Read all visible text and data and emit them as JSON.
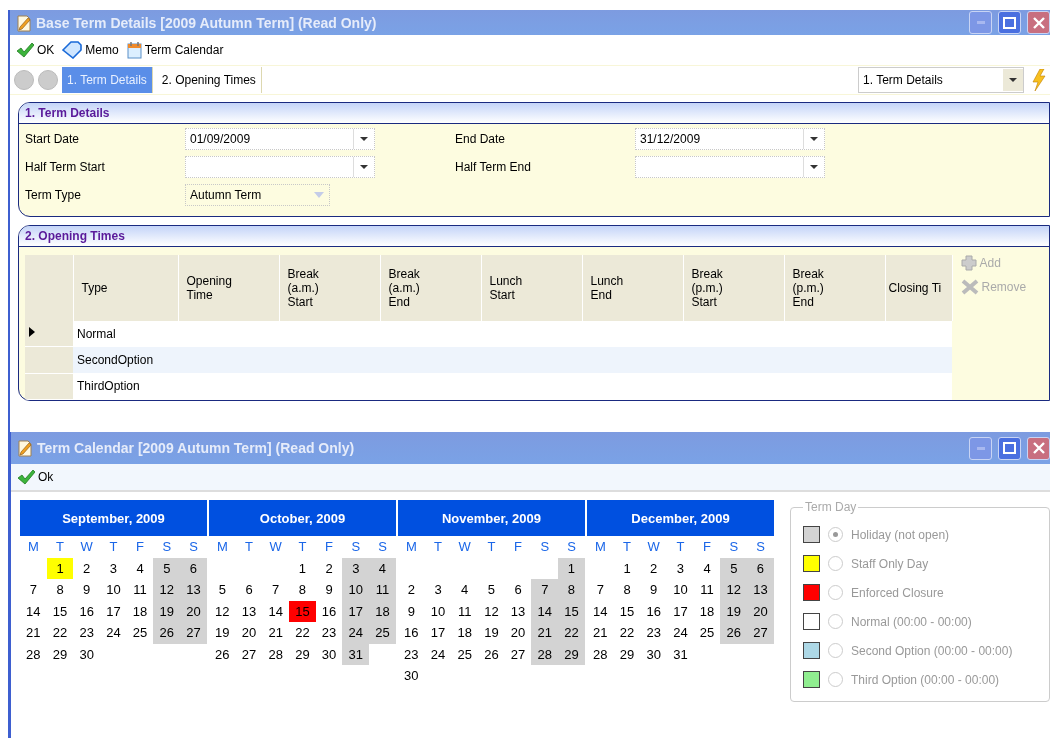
{
  "window": {
    "title": "Base Term Details [2009 Autumn Term] (Read Only)"
  },
  "toolbar": [
    {
      "label": "OK",
      "kind": "ok"
    },
    {
      "label": "Memo",
      "kind": "memo"
    },
    {
      "label": "Term Calendar",
      "kind": "calendar"
    }
  ],
  "tabs": [
    {
      "label": "1. Term Details",
      "selected": true
    },
    {
      "label": "2. Opening Times",
      "selected": false
    }
  ],
  "page_select": {
    "value": "1. Term Details"
  },
  "term_details": {
    "title": "1. Term Details",
    "fields": [
      {
        "label": "Start Date",
        "value": "01/09/2009",
        "kind": "date"
      },
      {
        "label": "End Date",
        "value": "31/12/2009",
        "kind": "date"
      },
      {
        "label": "Half Term Start",
        "kind": "date"
      },
      {
        "label": "Half Term End",
        "kind": "date"
      },
      {
        "label": "Term Type",
        "value": "Autumn Term",
        "kind": "combo"
      }
    ]
  },
  "opening_times": {
    "title": "2. Opening Times",
    "columns": [
      "Type",
      "Opening\nTime",
      "Break\n(a.m.)\nStart",
      "Break\n(a.m.)\nEnd",
      "Lunch\nStart",
      "Lunch\nEnd",
      "Break\n(p.m.)\nStart",
      "Break\n(p.m.)\nEnd",
      "Closing Ti"
    ],
    "rows": [
      {
        "type": "Normal",
        "current": true
      },
      {
        "type": "SecondOption",
        "current": false
      },
      {
        "type": "ThirdOption",
        "current": false
      }
    ],
    "actions": [
      {
        "label": "Add",
        "kind": "add"
      },
      {
        "label": "Remove",
        "kind": "remove"
      }
    ]
  },
  "calendar_window": {
    "title": "Term Calendar [2009 Autumn Term] (Read Only)",
    "ok": "Ok",
    "months": [
      {
        "title": "September, 2009",
        "weekdays": [
          "M",
          "T",
          "W",
          "T",
          "F",
          "S",
          "S"
        ],
        "weeks": [
          [
            {
              "kind": "blank"
            },
            {
              "d": "1",
              "kind": "staff"
            },
            {
              "d": "2",
              "kind": "normal"
            },
            {
              "d": "3",
              "kind": "normal"
            },
            {
              "d": "4",
              "kind": "normal"
            },
            {
              "d": "5",
              "kind": "holiday"
            },
            {
              "d": "6",
              "kind": "holiday"
            }
          ],
          [
            {
              "d": "7",
              "kind": "normal"
            },
            {
              "d": "8",
              "kind": "normal"
            },
            {
              "d": "9",
              "kind": "normal"
            },
            {
              "d": "10",
              "kind": "normal"
            },
            {
              "d": "11",
              "kind": "normal"
            },
            {
              "d": "12",
              "kind": "holiday"
            },
            {
              "d": "13",
              "kind": "holiday"
            }
          ],
          [
            {
              "d": "14",
              "kind": "normal"
            },
            {
              "d": "15",
              "kind": "normal"
            },
            {
              "d": "16",
              "kind": "normal"
            },
            {
              "d": "17",
              "kind": "normal"
            },
            {
              "d": "18",
              "kind": "normal"
            },
            {
              "d": "19",
              "kind": "holiday"
            },
            {
              "d": "20",
              "kind": "holiday"
            }
          ],
          [
            {
              "d": "21",
              "kind": "normal"
            },
            {
              "d": "22",
              "kind": "normal"
            },
            {
              "d": "23",
              "kind": "normal"
            },
            {
              "d": "24",
              "kind": "normal"
            },
            {
              "d": "25",
              "kind": "normal"
            },
            {
              "d": "26",
              "kind": "holiday"
            },
            {
              "d": "27",
              "kind": "holiday"
            }
          ],
          [
            {
              "d": "28",
              "kind": "normal"
            },
            {
              "d": "29",
              "kind": "normal"
            },
            {
              "d": "30",
              "kind": "normal"
            }
          ]
        ]
      },
      {
        "title": "October, 2009",
        "weekdays": [
          "M",
          "T",
          "W",
          "T",
          "F",
          "S",
          "S"
        ],
        "weeks": [
          [
            {
              "kind": "blank"
            },
            {
              "kind": "blank"
            },
            {
              "kind": "blank"
            },
            {
              "d": "1",
              "kind": "normal"
            },
            {
              "d": "2",
              "kind": "normal"
            },
            {
              "d": "3",
              "kind": "holiday"
            },
            {
              "d": "4",
              "kind": "holiday"
            }
          ],
          [
            {
              "d": "5",
              "kind": "normal"
            },
            {
              "d": "6",
              "kind": "normal"
            },
            {
              "d": "7",
              "kind": "normal"
            },
            {
              "d": "8",
              "kind": "normal"
            },
            {
              "d": "9",
              "kind": "normal"
            },
            {
              "d": "10",
              "kind": "holiday"
            },
            {
              "d": "11",
              "kind": "holiday"
            }
          ],
          [
            {
              "d": "12",
              "kind": "normal"
            },
            {
              "d": "13",
              "kind": "normal"
            },
            {
              "d": "14",
              "kind": "normal"
            },
            {
              "d": "15",
              "kind": "closure"
            },
            {
              "d": "16",
              "kind": "normal"
            },
            {
              "d": "17",
              "kind": "holiday"
            },
            {
              "d": "18",
              "kind": "holiday"
            }
          ],
          [
            {
              "d": "19",
              "kind": "normal"
            },
            {
              "d": "20",
              "kind": "normal"
            },
            {
              "d": "21",
              "kind": "normal"
            },
            {
              "d": "22",
              "kind": "normal"
            },
            {
              "d": "23",
              "kind": "normal"
            },
            {
              "d": "24",
              "kind": "holiday"
            },
            {
              "d": "25",
              "kind": "holiday"
            }
          ],
          [
            {
              "d": "26",
              "kind": "normal"
            },
            {
              "d": "27",
              "kind": "normal"
            },
            {
              "d": "28",
              "kind": "normal"
            },
            {
              "d": "29",
              "kind": "normal"
            },
            {
              "d": "30",
              "kind": "normal"
            },
            {
              "d": "31",
              "kind": "holiday"
            }
          ]
        ]
      },
      {
        "title": "November, 2009",
        "weekdays": [
          "M",
          "T",
          "W",
          "T",
          "F",
          "S",
          "S"
        ],
        "weeks": [
          [
            {
              "kind": "blank"
            },
            {
              "kind": "blank"
            },
            {
              "kind": "blank"
            },
            {
              "kind": "blank"
            },
            {
              "kind": "blank"
            },
            {
              "kind": "blank"
            },
            {
              "d": "1",
              "kind": "holiday"
            }
          ],
          [
            {
              "d": "2",
              "kind": "normal"
            },
            {
              "d": "3",
              "kind": "normal"
            },
            {
              "d": "4",
              "kind": "normal"
            },
            {
              "d": "5",
              "kind": "normal"
            },
            {
              "d": "6",
              "kind": "normal"
            },
            {
              "d": "7",
              "kind": "holiday"
            },
            {
              "d": "8",
              "kind": "holiday"
            }
          ],
          [
            {
              "d": "9",
              "kind": "normal"
            },
            {
              "d": "10",
              "kind": "normal"
            },
            {
              "d": "11",
              "kind": "normal"
            },
            {
              "d": "12",
              "kind": "normal"
            },
            {
              "d": "13",
              "kind": "normal"
            },
            {
              "d": "14",
              "kind": "holiday"
            },
            {
              "d": "15",
              "kind": "holiday"
            }
          ],
          [
            {
              "d": "16",
              "kind": "normal"
            },
            {
              "d": "17",
              "kind": "normal"
            },
            {
              "d": "18",
              "kind": "normal"
            },
            {
              "d": "19",
              "kind": "normal"
            },
            {
              "d": "20",
              "kind": "normal"
            },
            {
              "d": "21",
              "kind": "holiday"
            },
            {
              "d": "22",
              "kind": "holiday"
            }
          ],
          [
            {
              "d": "23",
              "kind": "normal"
            },
            {
              "d": "24",
              "kind": "normal"
            },
            {
              "d": "25",
              "kind": "normal"
            },
            {
              "d": "26",
              "kind": "normal"
            },
            {
              "d": "27",
              "kind": "normal"
            },
            {
              "d": "28",
              "kind": "holiday"
            },
            {
              "d": "29",
              "kind": "holiday"
            }
          ],
          [
            {
              "d": "30",
              "kind": "normal"
            }
          ]
        ]
      },
      {
        "title": "December, 2009",
        "weekdays": [
          "M",
          "T",
          "W",
          "T",
          "F",
          "S",
          "S"
        ],
        "weeks": [
          [
            {
              "kind": "blank"
            },
            {
              "d": "1",
              "kind": "normal"
            },
            {
              "d": "2",
              "kind": "normal"
            },
            {
              "d": "3",
              "kind": "normal"
            },
            {
              "d": "4",
              "kind": "normal"
            },
            {
              "d": "5",
              "kind": "holiday"
            },
            {
              "d": "6",
              "kind": "holiday"
            }
          ],
          [
            {
              "d": "7",
              "kind": "normal"
            },
            {
              "d": "8",
              "kind": "normal"
            },
            {
              "d": "9",
              "kind": "normal"
            },
            {
              "d": "10",
              "kind": "normal"
            },
            {
              "d": "11",
              "kind": "normal"
            },
            {
              "d": "12",
              "kind": "holiday"
            },
            {
              "d": "13",
              "kind": "holiday"
            }
          ],
          [
            {
              "d": "14",
              "kind": "normal"
            },
            {
              "d": "15",
              "kind": "normal"
            },
            {
              "d": "16",
              "kind": "normal"
            },
            {
              "d": "17",
              "kind": "normal"
            },
            {
              "d": "18",
              "kind": "normal"
            },
            {
              "d": "19",
              "kind": "holiday"
            },
            {
              "d": "20",
              "kind": "holiday"
            }
          ],
          [
            {
              "d": "21",
              "kind": "normal"
            },
            {
              "d": "22",
              "kind": "normal"
            },
            {
              "d": "23",
              "kind": "normal"
            },
            {
              "d": "24",
              "kind": "normal"
            },
            {
              "d": "25",
              "kind": "normal"
            },
            {
              "d": "26",
              "kind": "holiday"
            },
            {
              "d": "27",
              "kind": "holiday"
            }
          ],
          [
            {
              "d": "28",
              "kind": "normal"
            },
            {
              "d": "29",
              "kind": "normal"
            },
            {
              "d": "30",
              "kind": "normal"
            },
            {
              "d": "31",
              "kind": "normal"
            }
          ]
        ]
      }
    ],
    "legend": {
      "title": "Term Day",
      "items": [
        {
          "label": "Holiday (not open)",
          "kind": "holiday",
          "color": "#d3d3d3",
          "selected": true
        },
        {
          "label": "Staff Only Day",
          "kind": "staff",
          "color": "#ffff00",
          "selected": false
        },
        {
          "label": "Enforced Closure",
          "kind": "closure",
          "color": "#ff0000",
          "selected": false
        },
        {
          "label": "Normal (00:00 - 00:00)",
          "kind": "normal",
          "color": "#ffffff",
          "selected": false
        },
        {
          "label": "Second Option (00:00 - 00:00)",
          "kind": "second",
          "color": "#add8e6",
          "selected": false
        },
        {
          "label": "Third Option (00:00 - 00:00)",
          "kind": "third",
          "color": "#90ee90",
          "selected": false
        }
      ]
    }
  }
}
